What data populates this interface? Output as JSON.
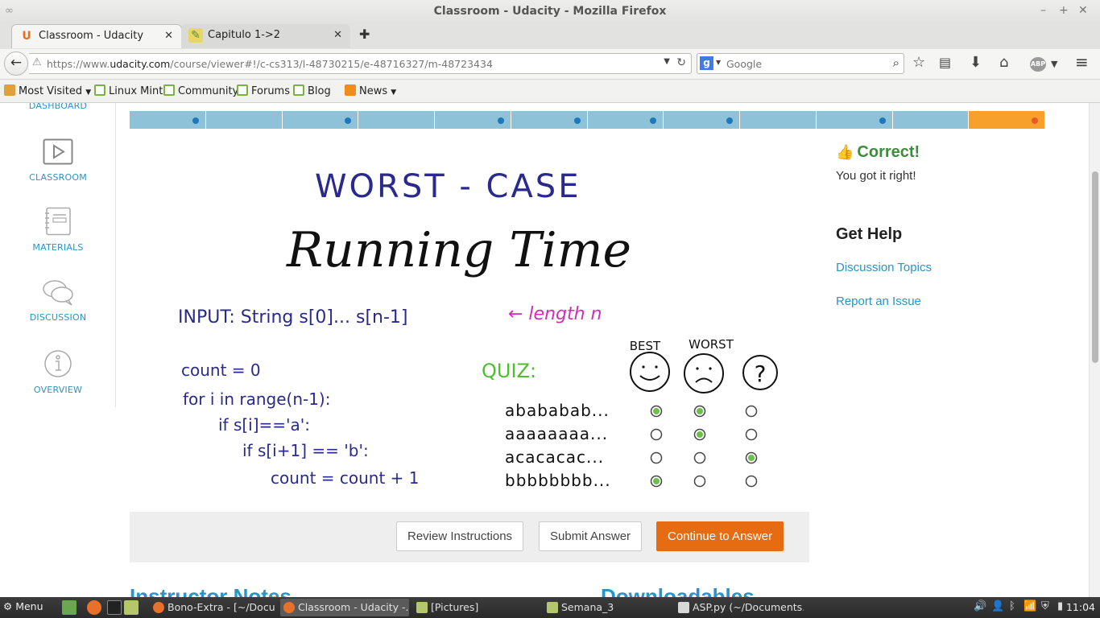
{
  "window": {
    "title": "Classroom - Udacity - Mozilla Firefox"
  },
  "tabs": [
    {
      "label": "Classroom - Udacity",
      "favicon": "U"
    },
    {
      "label": "Capitulo 1->2",
      "favicon": "✎"
    }
  ],
  "nav": {
    "url_prefix": "https://www.",
    "url_domain": "udacity.com",
    "url_path": "/course/viewer#!/c-cs313/l-48730215/e-48716327/m-48723434",
    "search_engine": "g",
    "search_placeholder": "Google",
    "abp": "ABP"
  },
  "bookmarks": [
    {
      "label": "Most Visited",
      "icon": "folder-icon",
      "dropdown": true
    },
    {
      "label": "Linux Mint",
      "icon": "mint-icon"
    },
    {
      "label": "Community",
      "icon": "mint-icon"
    },
    {
      "label": "Forums",
      "icon": "mint-icon"
    },
    {
      "label": "Blog",
      "icon": "mint-icon"
    },
    {
      "label": "News",
      "icon": "rss-icon",
      "dropdown": true
    }
  ],
  "sidebar": {
    "dashboard_label": "DASHBOARD",
    "items": [
      {
        "label": "CLASSROOM",
        "icon": "play-icon"
      },
      {
        "label": "MATERIALS",
        "icon": "notebook-icon"
      },
      {
        "label": "DISCUSSION",
        "icon": "chat-icon"
      },
      {
        "label": "OVERVIEW",
        "icon": "info-icon"
      }
    ]
  },
  "progress": {
    "segments": 12,
    "completed_dots": [
      1,
      3,
      5,
      6,
      7,
      8,
      10
    ],
    "current": 12,
    "colors": {
      "done": "#8ec2d8",
      "current": "#f7a12c",
      "dot": "#1f78b9",
      "current_dot": "#e65a2a"
    }
  },
  "lesson": {
    "heading1": "WORST - CASE",
    "heading2": "Running Time",
    "input_line": "INPUT: String s[0]... s[n-1]",
    "input_note": "← length n",
    "code": [
      "count = 0",
      "for i in range(n-1):",
      "if s[i]=='a':",
      "if s[i+1] == 'b':",
      "count = count + 1"
    ],
    "quiz_label": "QUIZ:",
    "columns": [
      "BEST",
      "WORST",
      "?"
    ],
    "rows": [
      {
        "label": "abababab...",
        "selected": [
          0,
          1
        ]
      },
      {
        "label": "aaaaaaaa...",
        "selected": [
          1
        ]
      },
      {
        "label": "acacacac...",
        "selected": [
          2
        ]
      },
      {
        "label": "bbbbbbbb...",
        "selected": [
          0
        ]
      }
    ]
  },
  "controls": {
    "review": "Review Instructions",
    "submit": "Submit Answer",
    "continue": "Continue to Answer"
  },
  "feedback": {
    "status": "Correct!",
    "message": "You got it right!"
  },
  "help": {
    "title": "Get Help",
    "links": [
      "Discussion Topics",
      "Report an Issue"
    ]
  },
  "below": {
    "instructor_notes": "Instructor Notes",
    "downloadables": "Downloadables"
  },
  "taskbar": {
    "menu": "Menu",
    "windows": [
      {
        "label": "Bono-Extra - [~/Docu..."
      },
      {
        "label": "Classroom - Udacity -..."
      },
      {
        "label": "[Pictures]"
      },
      {
        "label": "Semana_3"
      },
      {
        "label": "ASP.py (~/Documents..."
      }
    ],
    "clock": "11:04"
  },
  "colors": {
    "accent": "#2a93c7",
    "success": "#3d8b3d",
    "primary_button": "#e76b11",
    "handwriting_blue": "#2a2a8c",
    "handwriting_magenta": "#d22bb8",
    "handwriting_green": "#49c229"
  }
}
